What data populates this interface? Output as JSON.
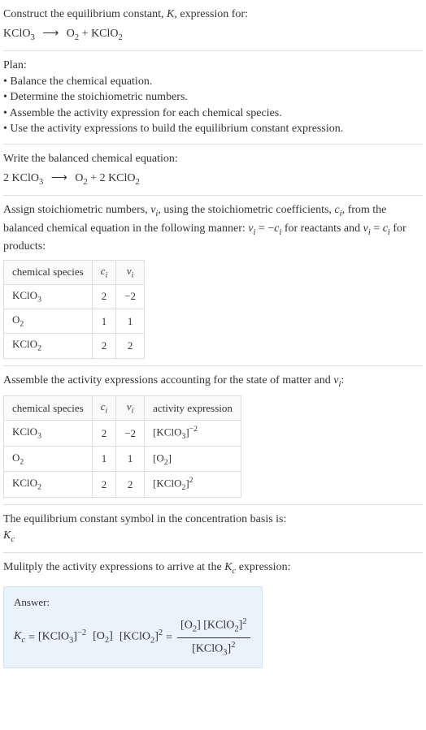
{
  "intro": {
    "title_line1": "Construct the equilibrium constant, ",
    "title_K": "K",
    "title_line1b": ", expression for:",
    "reaction_lhs": "KClO",
    "reaction_lhs_sub": "3",
    "arrow": "⟶",
    "reaction_rhs1": "O",
    "reaction_rhs1_sub": "2",
    "reaction_plus": " + ",
    "reaction_rhs2": "KClO",
    "reaction_rhs2_sub": "2"
  },
  "plan": {
    "heading": "Plan:",
    "items": [
      "Balance the chemical equation.",
      "Determine the stoichiometric numbers.",
      "Assemble the activity expression for each chemical species.",
      "Use the activity expressions to build the equilibrium constant expression."
    ]
  },
  "balanced": {
    "heading": "Write the balanced chemical equation:",
    "c1": "2 ",
    "s1": "KClO",
    "s1_sub": "3",
    "arrow": "⟶",
    "s2": "O",
    "s2_sub": "2",
    "plus": " + ",
    "c3": "2 ",
    "s3": "KClO",
    "s3_sub": "2"
  },
  "stoich": {
    "text1": "Assign stoichiometric numbers, ",
    "nu": "ν",
    "i": "i",
    "text2": ", using the stoichiometric coefficients, ",
    "c": "c",
    "text3": ", from the balanced chemical equation in the following manner: ",
    "eq1a": "ν",
    "eq1b": " = −",
    "eq1c": "c",
    "text4": " for reactants and ",
    "eq2a": "ν",
    "eq2b": " = ",
    "eq2c": "c",
    "text5": " for products:",
    "headers": {
      "h1": "chemical species",
      "h2": "c",
      "h2_sub": "i",
      "h3": "ν",
      "h3_sub": "i"
    },
    "rows": [
      {
        "species": "KClO",
        "species_sub": "3",
        "c": "2",
        "nu": "−2"
      },
      {
        "species": "O",
        "species_sub": "2",
        "c": "1",
        "nu": "1"
      },
      {
        "species": "KClO",
        "species_sub": "2",
        "c": "2",
        "nu": "2"
      }
    ]
  },
  "activity": {
    "text1": "Assemble the activity expressions accounting for the state of matter and ",
    "nu": "ν",
    "i": "i",
    "text2": ":",
    "headers": {
      "h1": "chemical species",
      "h2": "c",
      "h2_sub": "i",
      "h3": "ν",
      "h3_sub": "i",
      "h4": "activity expression"
    },
    "rows": [
      {
        "species": "KClO",
        "species_sub": "3",
        "c": "2",
        "nu": "−2",
        "act_base": "[KClO",
        "act_sub": "3",
        "act_close": "]",
        "act_sup": "−2"
      },
      {
        "species": "O",
        "species_sub": "2",
        "c": "1",
        "nu": "1",
        "act_base": "[O",
        "act_sub": "2",
        "act_close": "]",
        "act_sup": ""
      },
      {
        "species": "KClO",
        "species_sub": "2",
        "c": "2",
        "nu": "2",
        "act_base": "[KClO",
        "act_sub": "2",
        "act_close": "]",
        "act_sup": "2"
      }
    ]
  },
  "basis": {
    "text": "The equilibrium constant symbol in the concentration basis is:",
    "K": "K",
    "c": "c"
  },
  "multiply": {
    "text1": "Mulitply the activity expressions to arrive at the ",
    "K": "K",
    "c": "c",
    "text2": " expression:"
  },
  "answer": {
    "label": "Answer:",
    "K": "K",
    "c": "c",
    "eq": " = ",
    "t1": "[KClO",
    "t1_sub": "3",
    "t1_close": "]",
    "t1_sup": "−2",
    "sp": " ",
    "t2": "[O",
    "t2_sub": "2",
    "t2_close": "]",
    "t3": "[KClO",
    "t3_sub": "2",
    "t3_close": "]",
    "t3_sup": "2",
    "eq2": " = ",
    "num1": "[O",
    "num1_sub": "2",
    "num1_close": "] ",
    "num2": "[KClO",
    "num2_sub": "2",
    "num2_close": "]",
    "num2_sup": "2",
    "den": "[KClO",
    "den_sub": "3",
    "den_close": "]",
    "den_sup": "2"
  }
}
